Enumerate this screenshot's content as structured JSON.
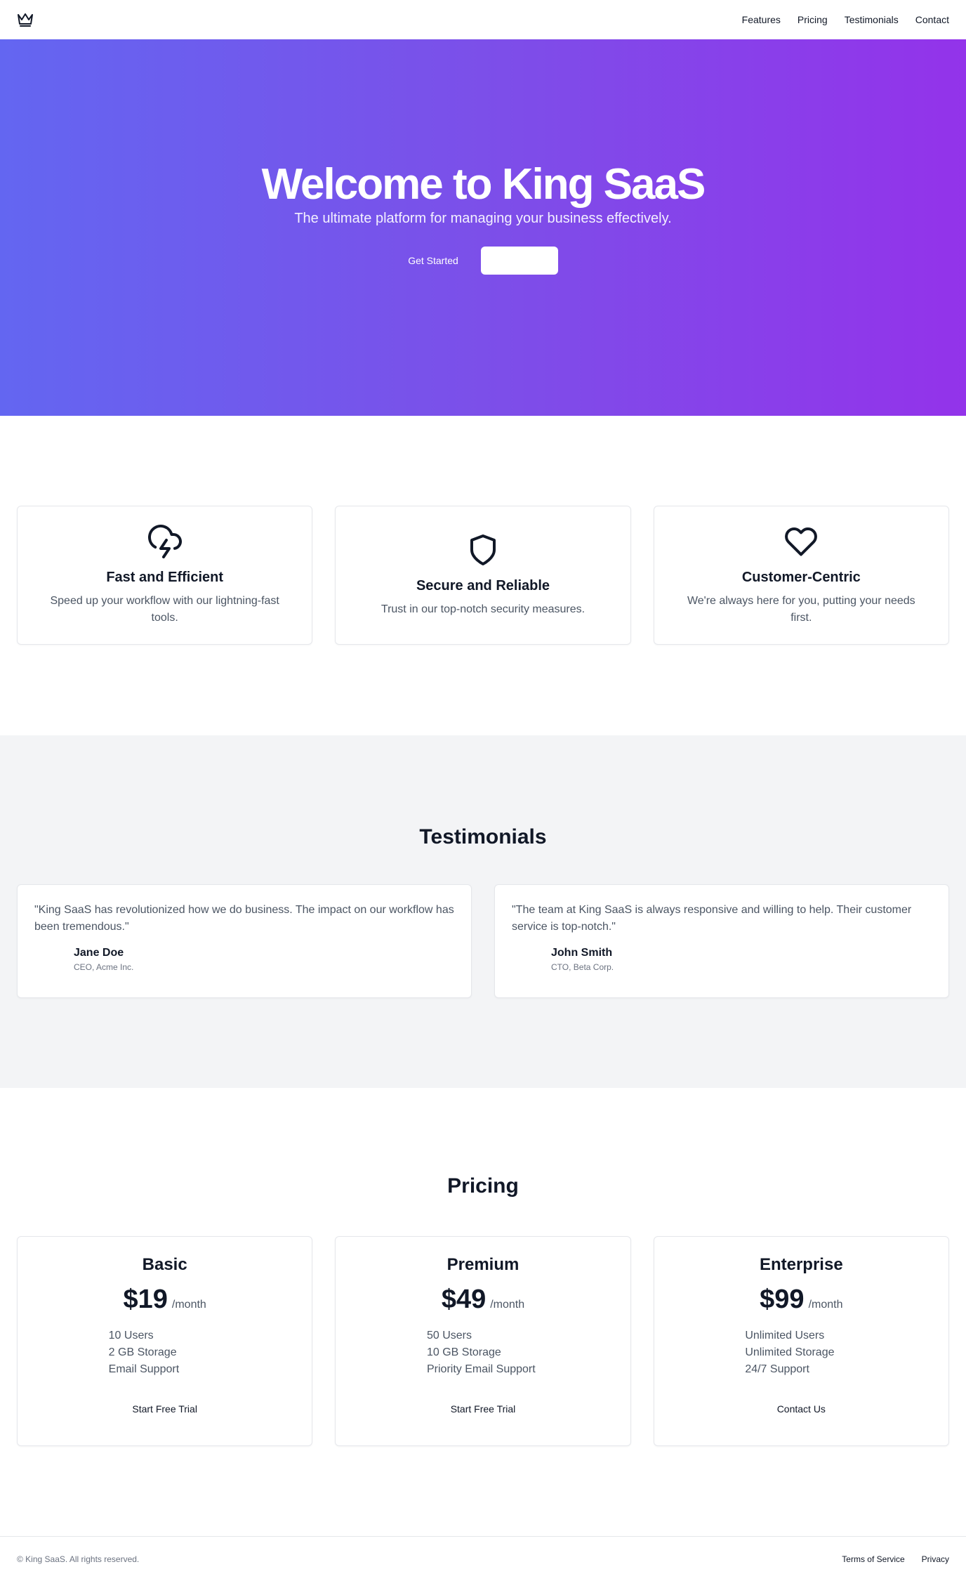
{
  "header": {
    "logo_icon": "crown-icon",
    "nav": [
      "Features",
      "Pricing",
      "Testimonials",
      "Contact"
    ]
  },
  "hero": {
    "title": "Welcome to King SaaS",
    "subtitle": "The ultimate platform for managing your business effectively.",
    "primary_button": "Get Started",
    "secondary_button": "",
    "gradient": [
      "#6366f1",
      "#9333ea"
    ]
  },
  "features": [
    {
      "icon": "cloud-lightning-icon",
      "title": "Fast and Efficient",
      "description": "Speed up your workflow with our lightning-fast tools."
    },
    {
      "icon": "shield-icon",
      "title": "Secure and Reliable",
      "description": "Trust in our top-notch security measures."
    },
    {
      "icon": "heart-icon",
      "title": "Customer-Centric",
      "description": "We're always here for you, putting your needs first."
    }
  ],
  "testimonials": {
    "title": "Testimonials",
    "items": [
      {
        "quote": "\"King SaaS has revolutionized how we do business. The impact on our workflow has been tremendous.\"",
        "name": "Jane Doe",
        "role": "CEO, Acme Inc."
      },
      {
        "quote": "\"The team at King SaaS is always responsive and willing to help. Their customer service is top-notch.\"",
        "name": "John Smith",
        "role": "CTO, Beta Corp."
      }
    ]
  },
  "pricing": {
    "title": "Pricing",
    "plans": [
      {
        "name": "Basic",
        "price": "$19",
        "period": "/month",
        "features": [
          "10 Users",
          "2 GB Storage",
          "Email Support"
        ],
        "cta": "Start Free Trial"
      },
      {
        "name": "Premium",
        "price": "$49",
        "period": "/month",
        "features": [
          "50 Users",
          "10 GB Storage",
          "Priority Email Support"
        ],
        "cta": "Start Free Trial"
      },
      {
        "name": "Enterprise",
        "price": "$99",
        "period": "/month",
        "features": [
          "Unlimited Users",
          "Unlimited Storage",
          "24/7 Support"
        ],
        "cta": "Contact Us"
      }
    ]
  },
  "footer": {
    "copyright": "© King SaaS. All rights reserved.",
    "links": [
      "Terms of Service",
      "Privacy"
    ]
  }
}
